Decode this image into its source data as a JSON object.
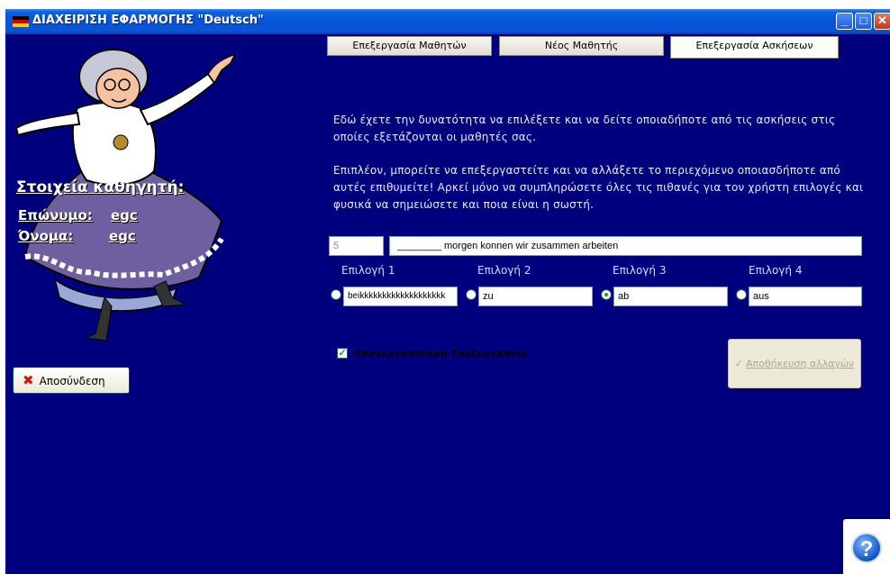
{
  "window": {
    "title": "ΔΙΑΧΕΙΡΙΣΗ ΕΦΑΡΜΟΓΗΣ \"Deutsch\"",
    "min_icon": "minimize-icon",
    "max_icon": "maximize-icon",
    "close_icon": "close-icon"
  },
  "tabs": [
    {
      "label": "Επεξεργασία Μαθητών"
    },
    {
      "label": "Νέος Μαθητής"
    },
    {
      "label": "Επεξεργασία Ασκήσεων"
    }
  ],
  "intro": {
    "p1": "Εδώ έχετε την δυνατότητα να επιλέξετε και να δείτε οποιαδήποτε από τις ασκήσεις στις οποίες εξετάζονται οι μαθητές σας.",
    "p2": "Επιπλέον, μπορείτε να επεξεργαστείτε και να αλλάξετε το περιεχόμενο οποιασδήποτε από αυτές επιθυμείτε! Αρκεί μόνο να συμπληρώσετε όλες τις πιθανές για τον χρήστη επιλογές και φυσικά να σημειώσετε και ποια είναι η σωστή."
  },
  "exercise": {
    "number": "5",
    "sentence": "________ morgen konnen wir zusammen arbeiten"
  },
  "options": [
    {
      "label": "Επιλογή 1",
      "value": "beikkkkkkkkkkkkkkkkkkk",
      "selected": false
    },
    {
      "label": "Επιλογή 2",
      "value": "zu",
      "selected": false
    },
    {
      "label": "Επιλογή 3",
      "value": "ab",
      "selected": true
    },
    {
      "label": "Επιλογή 4",
      "value": "aus",
      "selected": false
    }
  ],
  "edit_disable": {
    "label": "Απενεργοποίηση Επεξεργασίας",
    "checked": true
  },
  "save_button": {
    "label": "Αποθήκευση αλλαγών",
    "icon": "checkmark-icon"
  },
  "teacher": {
    "heading": "Στοιχεία καθηγητή:",
    "surname_label": "Επώνυμο:",
    "surname": "egc",
    "name_label": "Όνομα:",
    "name": "egc"
  },
  "logout_button": {
    "label": "Αποσύνδεση",
    "icon": "x-icon"
  },
  "help_icon": "help-icon",
  "colors": {
    "window_bg": "#00007e",
    "titlebar": "#0454d8",
    "dress": "#6d5fa0",
    "text_light": "#e8ecff"
  }
}
